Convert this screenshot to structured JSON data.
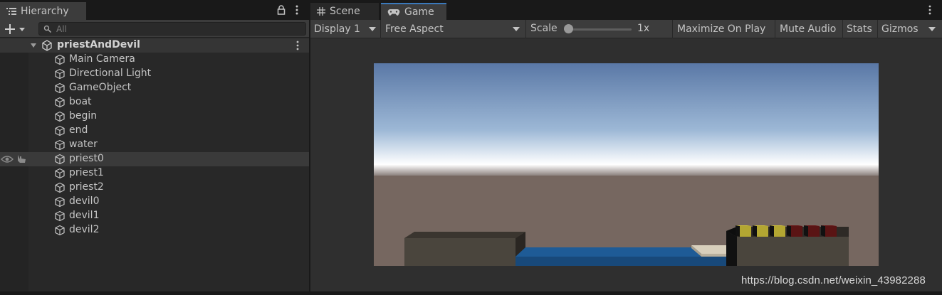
{
  "hierarchy": {
    "tab_label": "Hierarchy",
    "search_placeholder": "All",
    "scene": {
      "name": "priestAndDevil"
    },
    "objects": [
      {
        "name": "Main Camera"
      },
      {
        "name": "Directional Light"
      },
      {
        "name": "GameObject"
      },
      {
        "name": "boat"
      },
      {
        "name": "begin"
      },
      {
        "name": "end"
      },
      {
        "name": "water"
      },
      {
        "name": "priest0"
      },
      {
        "name": "priest1"
      },
      {
        "name": "priest2"
      },
      {
        "name": "devil0"
      },
      {
        "name": "devil1"
      },
      {
        "name": "devil2"
      }
    ],
    "hovered_index": 7
  },
  "tabs": {
    "scene_label": "Scene",
    "game_label": "Game",
    "active": "Game"
  },
  "game_toolbar": {
    "display": "Display 1",
    "aspect": "Free Aspect",
    "scale_label": "Scale",
    "scale_value": "1x",
    "maximize_label": "Maximize On Play",
    "mute_label": "Mute Audio",
    "stats_label": "Stats",
    "gizmos_label": "Gizmos"
  },
  "viewport": {
    "sky_colors": [
      "#5a78a6",
      "#9db8d6",
      "#ffffff",
      "#807571"
    ],
    "ground_color": "#766760",
    "water_color": "#1e5b96",
    "boat_color": "#cfc6b3",
    "priest_color": "#b3a632",
    "devil_color": "#5a1414",
    "bank_color": "#4a453d",
    "priest_count": 3,
    "devil_count": 3
  },
  "watermark": "https://blog.csdn.net/weixin_43982288",
  "colors": {
    "accent": "#3a79bb",
    "panel_bg": "#282828",
    "toolbar_bg": "#3c3c3c"
  }
}
